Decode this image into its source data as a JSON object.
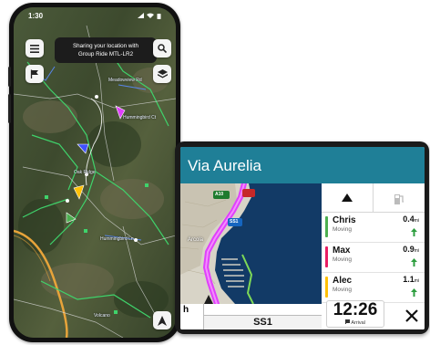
{
  "phone": {
    "status_time": "1:30",
    "share_banner": {
      "line1": "Sharing your location with",
      "line2": "Group Ride MTL-LR2"
    },
    "map_labels": [
      "Hummingbird Ct",
      "Hummingbird Ln",
      "Meadowview Rd",
      "Oak Ridge",
      "Volcano"
    ],
    "icons": {
      "menu": "menu-icon",
      "search": "search-icon",
      "flag": "flag-icon",
      "layers": "layers-icon",
      "locate": "navigation-arrow-icon"
    }
  },
  "car": {
    "street": "Via Aurelia",
    "road_shield_a": "A10",
    "road_shield_b": "SS1",
    "map_place": "Arcola",
    "speed_partial": "h",
    "road_name": "SS1",
    "arrival_time": "12:26",
    "arrival_label": "Arrival",
    "riders": [
      {
        "name": "Chris",
        "status": "Moving",
        "distance": "0.4",
        "unit": "mi",
        "color": "#4caf50"
      },
      {
        "name": "Max",
        "status": "Moving",
        "distance": "0.9",
        "unit": "mi",
        "color": "#e91e63"
      },
      {
        "name": "Alec",
        "status": "Moving",
        "distance": "1.1",
        "unit": "mi",
        "color": "#ffc107"
      }
    ]
  },
  "colors": {
    "header": "#1f7f97",
    "route": "#e040fb",
    "arrow_green": "#2e9e3f"
  }
}
